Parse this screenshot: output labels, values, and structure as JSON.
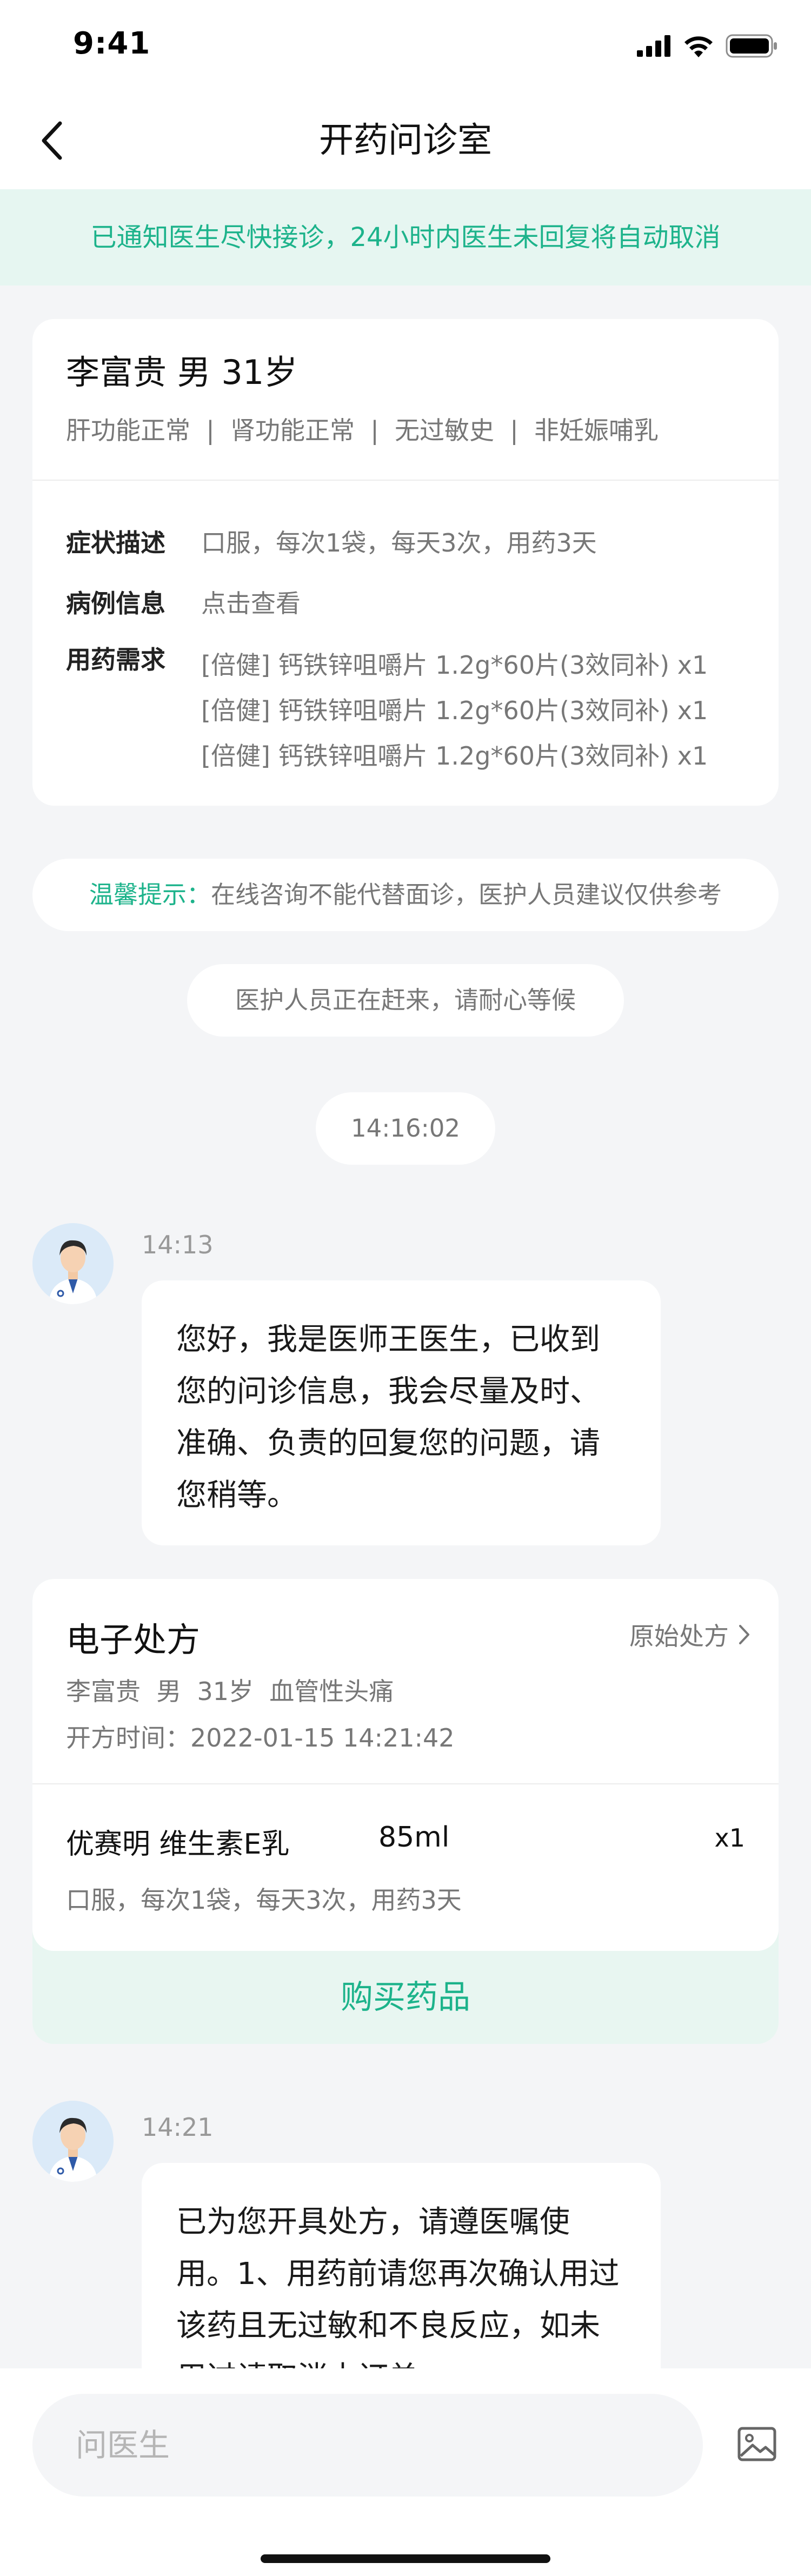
{
  "status_bar": {
    "time": "9:41",
    "icons": [
      "signal-icon",
      "wifi-icon",
      "battery-icon"
    ]
  },
  "nav": {
    "title": "开药问诊室",
    "back_icon": "chevron-left-icon"
  },
  "notice": "已通知医生尽快接诊，24小时内医生未回复将自动取消",
  "patient": {
    "name_line": "李富贵  男  31岁",
    "status_line": "肝功能正常  |  肾功能正常  |  无过敏史  |  非妊娠哺乳",
    "rows": {
      "symptom": {
        "label": "症状描述",
        "value": "口服，每次1袋，每天3次，用药3天"
      },
      "case": {
        "label": "病例信息",
        "value": "点击查看"
      },
      "needs": {
        "label": "用药需求",
        "items": [
          "[倍健] 钙铁锌咀嚼片 1.2g*60片(3效同补) x1",
          "[倍健] 钙铁锌咀嚼片 1.2g*60片(3效同补) x1",
          "[倍健] 钙铁锌咀嚼片 1.2g*60片(3效同补) x1"
        ]
      }
    }
  },
  "tips": {
    "label": "温馨提示：",
    "text": "在线咨询不能代替面诊，医护人员建议仅供参考"
  },
  "waiting_text": "医护人员正在赶来，请耐心等候",
  "timestamp": "14:16:02",
  "messages": [
    {
      "time": "14:13",
      "text": "您好，我是医师王医生，已收到您的问诊信息，我会尽量及时、准确、负责的回复您的问题，请您稍等。"
    },
    {
      "time": "14:21",
      "text": "已为您开具处方，请遵医嘱使用。1、用药前请您再次确认用过该药且无过敏和不良反应，如未用过请取消本订单；"
    }
  ],
  "prescription": {
    "title": "电子处方",
    "origin_link": "原始处方",
    "patient_line": "李富贵  男  31岁  血管性头痛",
    "date_line": "开方时间：2022-01-15 14:21:42",
    "drug_name": "优赛明 维生素E乳",
    "drug_volume": "85ml",
    "drug_qty": "x1",
    "usage": "口服，每次1袋，每天3次，用药3天",
    "buy_label": "购买药品"
  },
  "input": {
    "placeholder": "问医生",
    "image_icon": "image-icon"
  },
  "colors": {
    "accent": "#1db38b",
    "notice_bg": "#e6f6f1",
    "page_bg": "#f4f5f7"
  }
}
